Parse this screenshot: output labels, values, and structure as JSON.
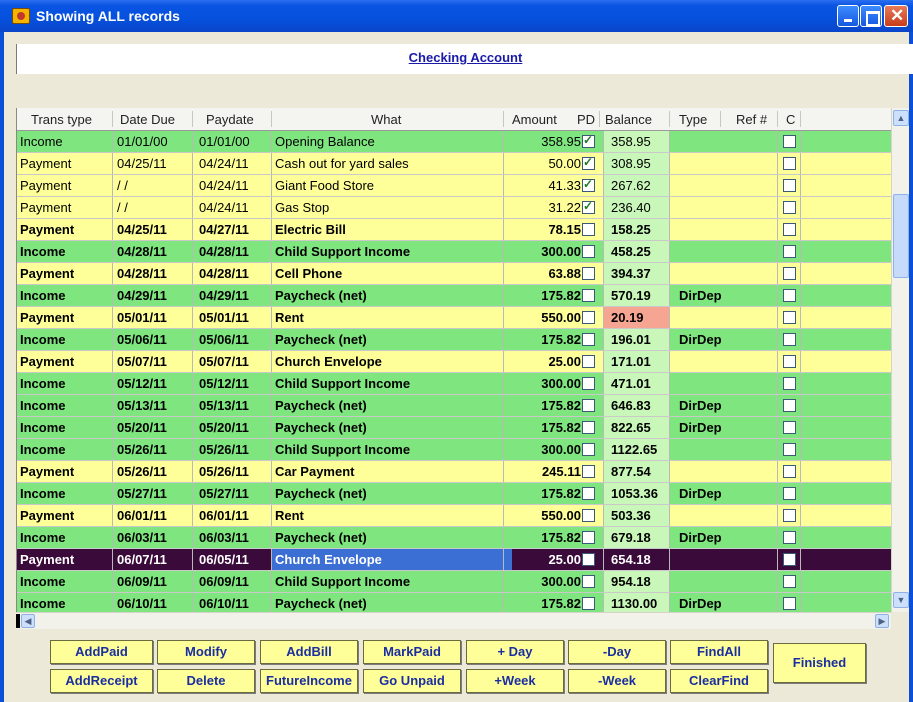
{
  "window": {
    "title": "Showing ALL records"
  },
  "header": {
    "account": "Checking Account"
  },
  "columns": [
    "Trans type",
    "Date Due",
    "Paydate",
    "What",
    "Amount",
    "PD",
    "Balance",
    "Type",
    "Ref #",
    "C"
  ],
  "rows": [
    {
      "type": "Income",
      "due": "01/01/00",
      "pay": "01/01/00",
      "what": "Opening Balance",
      "amount": "358.95",
      "pd": true,
      "balance": "358.95",
      "kind": "",
      "c": false,
      "bold": false,
      "neg": false,
      "sel": false
    },
    {
      "type": "Payment",
      "due": "04/25/11",
      "pay": "04/24/11",
      "what": "Cash out for yard sales",
      "amount": "50.00",
      "pd": true,
      "balance": "308.95",
      "kind": "",
      "c": false,
      "bold": false,
      "neg": false,
      "sel": false
    },
    {
      "type": "Payment",
      "due": "/ /",
      "pay": "04/24/11",
      "what": "Giant Food Store",
      "amount": "41.33",
      "pd": true,
      "balance": "267.62",
      "kind": "",
      "c": false,
      "bold": false,
      "neg": false,
      "sel": false
    },
    {
      "type": "Payment",
      "due": "/ /",
      "pay": "04/24/11",
      "what": "Gas Stop",
      "amount": "31.22",
      "pd": true,
      "balance": "236.40",
      "kind": "",
      "c": false,
      "bold": false,
      "neg": false,
      "sel": false
    },
    {
      "type": "Payment",
      "due": "04/25/11",
      "pay": "04/27/11",
      "what": "Electric Bill",
      "amount": "78.15",
      "pd": false,
      "balance": "158.25",
      "kind": "",
      "c": false,
      "bold": true,
      "neg": false,
      "sel": false
    },
    {
      "type": "Income",
      "due": "04/28/11",
      "pay": "04/28/11",
      "what": "Child Support Income",
      "amount": "300.00",
      "pd": false,
      "balance": "458.25",
      "kind": "",
      "c": false,
      "bold": true,
      "neg": false,
      "sel": false
    },
    {
      "type": "Payment",
      "due": "04/28/11",
      "pay": "04/28/11",
      "what": "Cell Phone",
      "amount": "63.88",
      "pd": false,
      "balance": "394.37",
      "kind": "",
      "c": false,
      "bold": true,
      "neg": false,
      "sel": false
    },
    {
      "type": "Income",
      "due": "04/29/11",
      "pay": "04/29/11",
      "what": "Paycheck (net)",
      "amount": "175.82",
      "pd": false,
      "balance": "570.19",
      "kind": "DirDep",
      "c": false,
      "bold": true,
      "neg": false,
      "sel": false
    },
    {
      "type": "Payment",
      "due": "05/01/11",
      "pay": "05/01/11",
      "what": "Rent",
      "amount": "550.00",
      "pd": false,
      "balance": "20.19",
      "kind": "",
      "c": false,
      "bold": true,
      "neg": true,
      "sel": false
    },
    {
      "type": "Income",
      "due": "05/06/11",
      "pay": "05/06/11",
      "what": "Paycheck (net)",
      "amount": "175.82",
      "pd": false,
      "balance": "196.01",
      "kind": "DirDep",
      "c": false,
      "bold": true,
      "neg": false,
      "sel": false
    },
    {
      "type": "Payment",
      "due": "05/07/11",
      "pay": "05/07/11",
      "what": "Church Envelope",
      "amount": "25.00",
      "pd": false,
      "balance": "171.01",
      "kind": "",
      "c": false,
      "bold": true,
      "neg": false,
      "sel": false
    },
    {
      "type": "Income",
      "due": "05/12/11",
      "pay": "05/12/11",
      "what": "Child Support Income",
      "amount": "300.00",
      "pd": false,
      "balance": "471.01",
      "kind": "",
      "c": false,
      "bold": true,
      "neg": false,
      "sel": false
    },
    {
      "type": "Income",
      "due": "05/13/11",
      "pay": "05/13/11",
      "what": "Paycheck (net)",
      "amount": "175.82",
      "pd": false,
      "balance": "646.83",
      "kind": "DirDep",
      "c": false,
      "bold": true,
      "neg": false,
      "sel": false
    },
    {
      "type": "Income",
      "due": "05/20/11",
      "pay": "05/20/11",
      "what": "Paycheck (net)",
      "amount": "175.82",
      "pd": false,
      "balance": "822.65",
      "kind": "DirDep",
      "c": false,
      "bold": true,
      "neg": false,
      "sel": false
    },
    {
      "type": "Income",
      "due": "05/26/11",
      "pay": "05/26/11",
      "what": "Child Support Income",
      "amount": "300.00",
      "pd": false,
      "balance": "1122.65",
      "kind": "",
      "c": false,
      "bold": true,
      "neg": false,
      "sel": false
    },
    {
      "type": "Payment",
      "due": "05/26/11",
      "pay": "05/26/11",
      "what": "Car Payment",
      "amount": "245.11",
      "pd": false,
      "balance": "877.54",
      "kind": "",
      "c": false,
      "bold": true,
      "neg": false,
      "sel": false
    },
    {
      "type": "Income",
      "due": "05/27/11",
      "pay": "05/27/11",
      "what": "Paycheck (net)",
      "amount": "175.82",
      "pd": false,
      "balance": "1053.36",
      "kind": "DirDep",
      "c": false,
      "bold": true,
      "neg": false,
      "sel": false
    },
    {
      "type": "Payment",
      "due": "06/01/11",
      "pay": "06/01/11",
      "what": "Rent",
      "amount": "550.00",
      "pd": false,
      "balance": "503.36",
      "kind": "",
      "c": false,
      "bold": true,
      "neg": false,
      "sel": false
    },
    {
      "type": "Income",
      "due": "06/03/11",
      "pay": "06/03/11",
      "what": "Paycheck (net)",
      "amount": "175.82",
      "pd": false,
      "balance": "679.18",
      "kind": "DirDep",
      "c": false,
      "bold": true,
      "neg": false,
      "sel": false
    },
    {
      "type": "Payment",
      "due": "06/07/11",
      "pay": "06/05/11",
      "what": "Church Envelope",
      "amount": "25.00",
      "pd": false,
      "balance": "654.18",
      "kind": "",
      "c": false,
      "bold": true,
      "neg": false,
      "sel": true
    },
    {
      "type": "Income",
      "due": "06/09/11",
      "pay": "06/09/11",
      "what": "Child Support Income",
      "amount": "300.00",
      "pd": false,
      "balance": "954.18",
      "kind": "",
      "c": false,
      "bold": true,
      "neg": false,
      "sel": false
    },
    {
      "type": "Income",
      "due": "06/10/11",
      "pay": "06/10/11",
      "what": "Paycheck (net)",
      "amount": "175.82",
      "pd": false,
      "balance": "1130.00",
      "kind": "DirDep",
      "c": false,
      "bold": true,
      "neg": false,
      "sel": false
    }
  ],
  "buttons": {
    "add_paid": "AddPaid",
    "add_receipt": "AddReceipt",
    "modify": "Modify",
    "delete": "Delete",
    "add_bill": "AddBill",
    "future_income": "FutureIncome",
    "mark_paid": "MarkPaid",
    "go_unpaid": "Go Unpaid",
    "plus_day": "+ Day",
    "plus_week": "+Week",
    "minus_day": "-Day",
    "minus_week": "-Week",
    "find_all": "FindAll",
    "clear_find": "ClearFind",
    "finished": "Finished"
  },
  "icons": {
    "app": "app-icon",
    "minimize": "minimize-icon",
    "maximize": "maximize-icon",
    "close": "close-icon"
  },
  "colors": {
    "income": "#7fe67f",
    "payment": "#ffff99",
    "selected": "#3a0a3a",
    "balance": "#c9f7b9",
    "balance_low": "#f6a592",
    "button_text": "#1a2ea0"
  }
}
